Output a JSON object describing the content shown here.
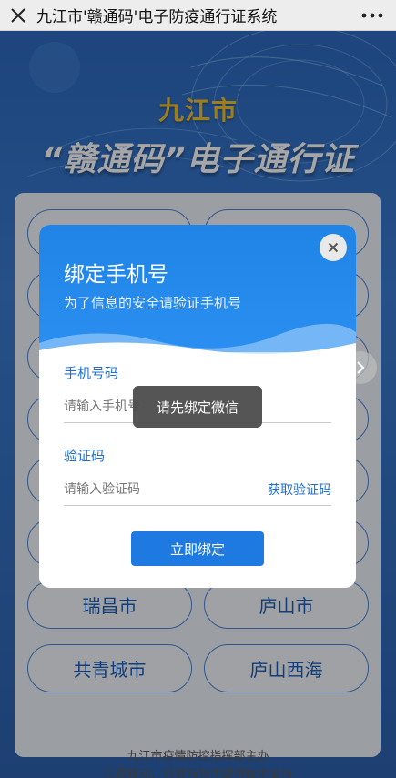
{
  "navbar": {
    "title": "九江市'赣通码'电子防疫通行证系统",
    "close_icon": "close-icon",
    "more_icon": "more-dots-icon"
  },
  "hero": {
    "city": "九江市",
    "title": "“赣通码”电子通行证"
  },
  "cities": [
    "瑞昌市",
    "庐山市",
    "共青城市",
    "庐山西海"
  ],
  "footer": {
    "line1": "九江市疫情防控指挥部主办",
    "line2": "江西移动、科睿特软件提供技术支持"
  },
  "modal": {
    "title": "绑定手机号",
    "subtitle": "为了信息的安全请验证手机号",
    "phone_label": "手机号码",
    "phone_placeholder": "请输入手机号",
    "phone_value": "",
    "code_label": "验证码",
    "code_placeholder": "请输入验证码",
    "code_value": "",
    "get_code": "获取验证码",
    "submit": "立即绑定"
  },
  "toast": "请先绑定微信",
  "colors": {
    "accent": "#1e7ae0",
    "hero_city": "#f2c230",
    "city_button_text": "#1d5fb8"
  }
}
